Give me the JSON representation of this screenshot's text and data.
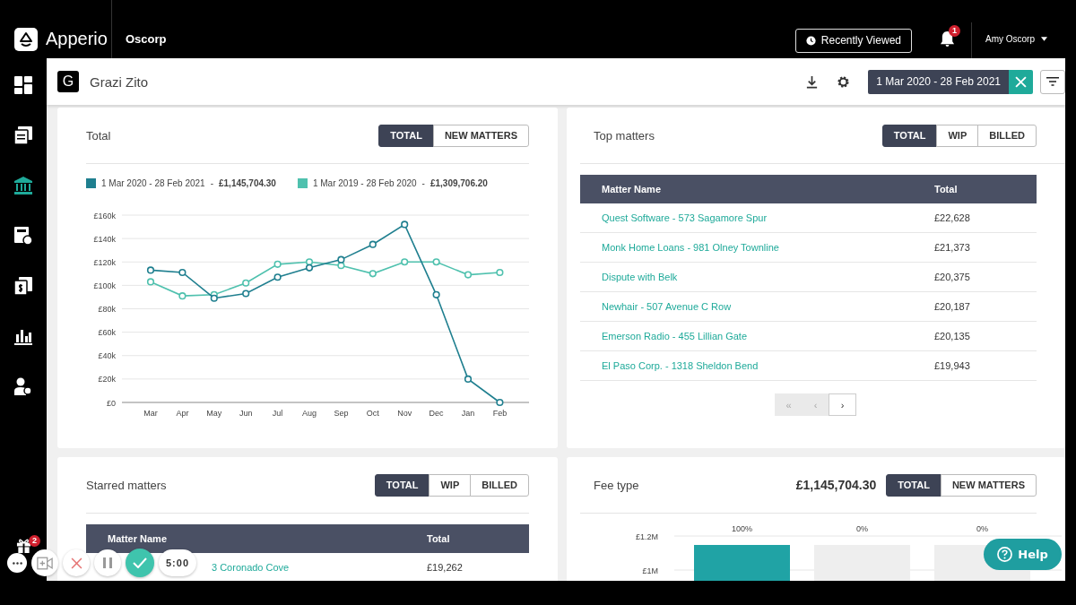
{
  "top_bar": {
    "app_name": "Apperio",
    "org": "Oscorp",
    "recently_viewed": "Recently Viewed",
    "notifications_badge": "1",
    "user": "Amy Oscorp"
  },
  "sidebar": {
    "items": [
      {
        "kind": "dashboard",
        "selected": false
      },
      {
        "kind": "documents",
        "selected": false
      },
      {
        "kind": "bank",
        "selected": true
      },
      {
        "kind": "calculator",
        "selected": false
      },
      {
        "kind": "invoice",
        "selected": false
      },
      {
        "kind": "chart",
        "selected": false
      },
      {
        "kind": "user-settings",
        "selected": false
      }
    ]
  },
  "header": {
    "avatar_letter": "G",
    "title": "Grazi Zito",
    "date_range": "1 Mar 2020 - 28 Feb 2021"
  },
  "total_card": {
    "title": "Total",
    "toggles": [
      {
        "label": "TOTAL",
        "selected": true
      },
      {
        "label": "NEW MATTERS",
        "selected": false
      }
    ],
    "legend_totals": [
      "£1,145,704.30",
      "£1,309,706.20"
    ],
    "legend_separator": "-",
    "chart_data": {
      "type": "line",
      "categories": [
        "Mar",
        "Apr",
        "May",
        "Jun",
        "Jul",
        "Aug",
        "Sep",
        "Oct",
        "Nov",
        "Dec",
        "Jan",
        "Feb"
      ],
      "grid": true,
      "series": [
        {
          "name": "1 Mar 2020 - 28 Feb 2021",
          "color": "#1f7f8f",
          "marker": true,
          "values": [
            113000,
            111000,
            89000,
            93000,
            107000,
            115000,
            122000,
            135000,
            152000,
            92000,
            20000,
            0
          ]
        },
        {
          "name": "1 Mar 2019 - 28 Feb 2020",
          "color": "#4fc1ae",
          "marker": true,
          "values": [
            103000,
            91000,
            92000,
            102000,
            118000,
            120000,
            117000,
            110000,
            120000,
            120000,
            109000,
            111000
          ]
        }
      ],
      "ylim": [
        0,
        160000
      ],
      "yticks": [
        {
          "value": 0,
          "label": "£0"
        },
        {
          "value": 20000,
          "label": "£20k"
        },
        {
          "value": 40000,
          "label": "£40k"
        },
        {
          "value": 60000,
          "label": "£60k"
        },
        {
          "value": 80000,
          "label": "£80k"
        },
        {
          "value": 100000,
          "label": "£100k"
        },
        {
          "value": 120000,
          "label": "£120k"
        },
        {
          "value": 140000,
          "label": "£140k"
        },
        {
          "value": 160000,
          "label": "£160k"
        }
      ]
    }
  },
  "top_matters": {
    "title": "Top matters",
    "toggles": [
      {
        "label": "TOTAL",
        "selected": true
      },
      {
        "label": "WIP",
        "selected": false
      },
      {
        "label": "BILLED",
        "selected": false
      }
    ],
    "columns": [
      "Matter Name",
      "Total"
    ],
    "rows": [
      {
        "name": "Quest Software - 573 Sagamore Spur",
        "total": "£22,628"
      },
      {
        "name": "Monk Home Loans - 981 Olney Townline",
        "total": "£21,373"
      },
      {
        "name": "Dispute with Belk",
        "total": "£20,375"
      },
      {
        "name": "Newhair - 507 Avenue C Row",
        "total": "£20,187"
      },
      {
        "name": "Emerson Radio - 455 Lillian Gate",
        "total": "£20,135"
      },
      {
        "name": "El Paso Corp. - 1318 Sheldon Bend",
        "total": "£19,943"
      }
    ],
    "pager": [
      {
        "label": "«",
        "disabled": true
      },
      {
        "label": "‹",
        "disabled": true
      },
      {
        "label": "›",
        "disabled": false
      }
    ]
  },
  "starred_matters": {
    "title": "Starred matters",
    "toggles": [
      {
        "label": "TOTAL",
        "selected": true
      },
      {
        "label": "WIP",
        "selected": false
      },
      {
        "label": "BILLED",
        "selected": false
      }
    ],
    "columns": [
      "Matter Name",
      "Total"
    ],
    "rows": [
      {
        "name": "3 Coronado Cove",
        "total": "£19,262"
      }
    ]
  },
  "fee_type": {
    "title": "Fee type",
    "amount": "£1,145,704.30",
    "toggles": [
      {
        "label": "TOTAL",
        "selected": true
      },
      {
        "label": "NEW MATTERS",
        "selected": false
      }
    ],
    "y_axis_labels": [
      "£1.2M",
      "£1M"
    ],
    "bars": [
      {
        "label": "100%",
        "filled": true
      },
      {
        "label": "0%",
        "filled": false
      },
      {
        "label": "0%",
        "filled": false
      }
    ]
  },
  "recorder": {
    "gift_badge": "2",
    "timer": "5:00"
  },
  "help": {
    "label": "Help"
  }
}
